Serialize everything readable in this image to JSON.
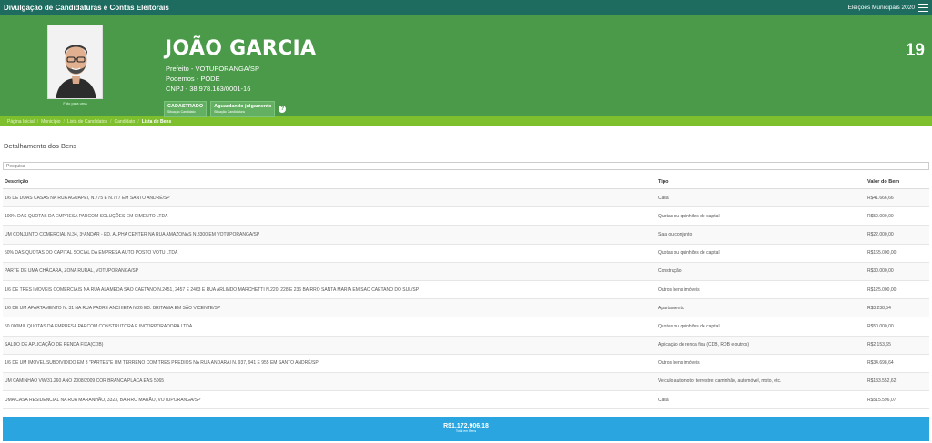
{
  "topbar": {
    "title": "Divulgação de Candidaturas e Contas Eleitorais",
    "election": "Eleições Municipais 2020"
  },
  "candidate": {
    "photo_caption": "Foto para urna",
    "name": "JOÃO GARCIA",
    "office": "Prefeito - VOTUPORANGA/SP",
    "party": "Podemos - PODE",
    "cnpj": "CNPJ - 38.978.163/0001-16",
    "number": "19",
    "badges": [
      {
        "main": "CADASTRADO",
        "sub": "Situação Candidato"
      },
      {
        "main": "Aguardando julgamento",
        "sub": "Situação Candidatura"
      }
    ],
    "help": "?"
  },
  "breadcrumb": [
    "Página Inicial",
    "Município",
    "Lista de Candidatos",
    "Candidato",
    "Lista de Bens"
  ],
  "section": {
    "title": "Detalhamento dos Bens",
    "search_placeholder": "Pesquisa"
  },
  "table": {
    "headers": [
      "Descrição",
      "Tipo",
      "Valor do Bem"
    ],
    "rows": [
      [
        "1/6 DE DUAS CASAS NA RUA AGUAPEI, N.775 E N.777 EM SANTO ANDRÉ/SP",
        "Casa",
        "R$41.666,66"
      ],
      [
        "100% DAS QUOTAS DA EMPRESA PARCOM SOLUÇÕES EM CIMENTO LTDA",
        "Quotas ou quinhões de capital",
        "R$50.000,00"
      ],
      [
        "UM CONJUNTO COMERCIAL N.34, 3ºANDAR - ED. ALPHA CENTER NA RUA AMAZONAS N.3300 EM VOTUPORANGA/SP",
        "Sala ou conjunto",
        "R$22.000,00"
      ],
      [
        "50% DAS QUOTAS DO CAPITAL SOCIAL DA EMPRESA AUTO POSTO VOTU LTDA",
        "Quotas ou quinhões de capital",
        "R$165.000,00"
      ],
      [
        "PARTE DE UMA CHÁCARA, ZONA RURAL, VOTUPORANGA/SP",
        "Construção",
        "R$30.000,00"
      ],
      [
        "1/6 DE TRES IMOVEIS COMERCIAIS NA RUA ALAMEDA SÃO CAETANO N.2451, 2457 E 2463 E RUA ARLINDO MARCHETTI N.220, 228 E 236 BAIRRO SANTA MARIA EM SÃO CAETANO DO SUL/SP",
        "Outros bens imóveis",
        "R$125.000,00"
      ],
      [
        "1/6 DE UM APARTAMENTO N. 31 NA RUA PADRE ANCHIETA N.26 ED. BRITANIA EM SÃO VICENTE/SP",
        "Apartamento",
        "R$3.238,54"
      ],
      [
        "50.000MIL QUOTAS DA EMPRESA PARCOM CONSTRUTORA E INCORPORADORA LTDA",
        "Quotas ou quinhões de capital",
        "R$50.000,00"
      ],
      [
        "SALDO DE APLICAÇÃO DE RENDA FIXA(CDB)",
        "Aplicação de renda fixa (CDB, RDB e outros)",
        "R$2.153,65"
      ],
      [
        "1/6 DE UM IMÓVEL SUBDIVIDIDO EM 3 \"PARTES\"E UM TERRENO COM TRES PREDIOS NA RUA ANDARAI N. 937, 941 E 955 EM SANTO ANDRÉ/SP",
        "Outros bens imóveis",
        "R$34.698,64"
      ],
      [
        "UM CAMINHÃO VW/31.260 ANO 2008/2009 COR BRANCA PLACA EAS 5065",
        "Veículo automotor terrestre: caminhão, automóvel, moto, etc.",
        "R$133.552,62"
      ],
      [
        "UMA CASA RESIDENCIAL NA RUA MARANHÃO, 3323, BAIRRO MARÃO, VOTUPORANGA/SP",
        "Casa",
        "R$515.596,07"
      ]
    ]
  },
  "total": {
    "amount": "R$1.172.906,18",
    "label": "Total em Bens"
  }
}
